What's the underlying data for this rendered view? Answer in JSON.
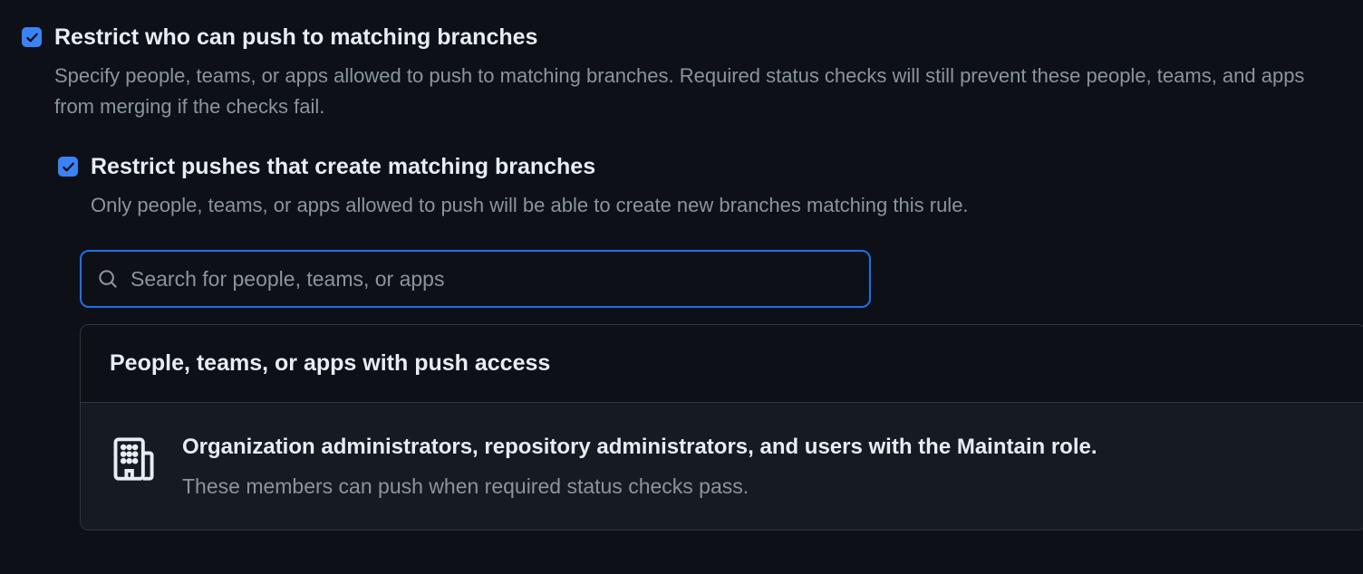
{
  "options": {
    "restrict_push": {
      "title": "Restrict who can push to matching branches",
      "description": "Specify people, teams, or apps allowed to push to matching branches. Required status checks will still prevent these people, teams, and apps from merging if the checks fail.",
      "checked": true
    },
    "restrict_create": {
      "title": "Restrict pushes that create matching branches",
      "description": "Only people, teams, or apps allowed to push will be able to create new branches matching this rule.",
      "checked": true
    }
  },
  "search": {
    "placeholder": "Search for people, teams, or apps",
    "value": ""
  },
  "panel": {
    "title": "People, teams, or apps with push access",
    "item_primary": "Organization administrators, repository administrators, and users with the Maintain role.",
    "item_secondary": "These members can push when required status checks pass."
  }
}
